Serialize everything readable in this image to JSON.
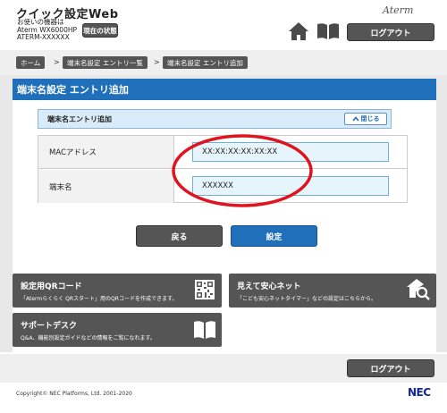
{
  "header": {
    "app_title": "クイック設定Web",
    "device_caption": "お使いの機器は",
    "device_model": "Aterm WX6000HP",
    "device_name": "ATERM-XXXXXX",
    "status_button": "現在の状態",
    "brand_logo": "Aterm",
    "logout_label": "ログアウト",
    "icons": [
      "home-icon",
      "book-icon"
    ]
  },
  "breadcrumb": [
    "ホーム",
    "端末名設定 エントリ一覧",
    "端末名設定 エントリ追加"
  ],
  "breadcrumb_separator": ">",
  "page_title": "端末名設定 エントリ追加",
  "section": {
    "title": "端末名エントリ追加",
    "collapse_label": "閉じる"
  },
  "form": {
    "mac": {
      "label": "MACアドレス",
      "value": "XX:XX:XX:XX:XX:XX"
    },
    "name": {
      "label": "端末名",
      "value": "XXXXXX"
    }
  },
  "buttons": {
    "back": "戻る",
    "submit": "設定"
  },
  "cards": {
    "qr": {
      "title": "設定用QRコード",
      "desc": "「Atermらくらく QRスタート」用のQRコードを作成できます。",
      "icon": "qr-code-icon"
    },
    "safe": {
      "title": "見えて安心ネット",
      "desc": "「こども安心ネットタイマー」などの設定はこちらから。",
      "icon": "house-search-icon"
    },
    "support": {
      "title": "サポートデスク",
      "desc": "Q&A、機能別設定ガイドなどの情報をご覧になれます。",
      "icon": "book-icon"
    }
  },
  "footer": {
    "logout_label": "ログアウト",
    "copyright": "Copyright© NEC Platforms, Ltd. 2001-2020",
    "brand": "NEC"
  },
  "colors": {
    "primary_blue": "#1f6fba",
    "dark_button": "#555555",
    "annotation_red": "#e0141e"
  }
}
